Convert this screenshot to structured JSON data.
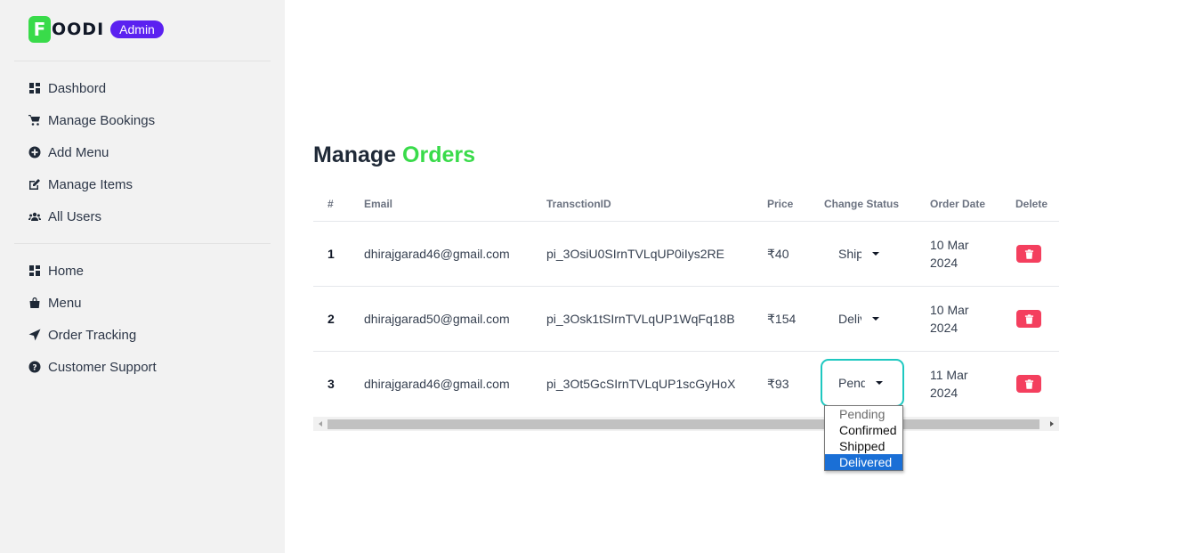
{
  "brand": {
    "logo_letter": "F",
    "logo_rest": "OODI",
    "badge": "Admin"
  },
  "sidebar": {
    "admin_items": [
      {
        "label": "Dashbord",
        "icon": "dashboard-icon"
      },
      {
        "label": "Manage Bookings",
        "icon": "cart-icon"
      },
      {
        "label": "Add Menu",
        "icon": "plus-circle-icon"
      },
      {
        "label": "Manage Items",
        "icon": "edit-icon"
      },
      {
        "label": "All Users",
        "icon": "users-icon"
      }
    ],
    "site_items": [
      {
        "label": "Home",
        "icon": "dashboard-icon"
      },
      {
        "label": "Menu",
        "icon": "shopping-bag-icon"
      },
      {
        "label": "Order Tracking",
        "icon": "location-arrow-icon"
      },
      {
        "label": "Customer Support",
        "icon": "question-circle-icon"
      }
    ]
  },
  "page": {
    "title_prefix": "Manage",
    "title_accent": "Orders"
  },
  "table": {
    "headers": [
      "#",
      "Email",
      "TransctionID",
      "Price",
      "Change Status",
      "Order Date",
      "Delete"
    ],
    "rows": [
      {
        "num": "1",
        "email": "dhirajgarad46@gmail.com",
        "txn": "pi_3OsiU0SIrnTVLqUP0iIys2RE",
        "price": "₹40",
        "status": "Shipped",
        "date_line1": "10 Mar",
        "date_line2": "2024"
      },
      {
        "num": "2",
        "email": "dhirajgarad50@gmail.com",
        "txn": "pi_3Osk1tSIrnTVLqUP1WqFq18B",
        "price": "₹154",
        "status": "Delivered",
        "date_line1": "10 Mar",
        "date_line2": "2024"
      },
      {
        "num": "3",
        "email": "dhirajgarad46@gmail.com",
        "txn": "pi_3Ot5GcSIrnTVLqUP1scGyHoX",
        "price": "₹93",
        "status": "Pending",
        "date_line1": "11 Mar",
        "date_line2": "2024"
      }
    ]
  },
  "status_dropdown": {
    "options": [
      "Pending",
      "Confirmed",
      "Shipped",
      "Delivered"
    ],
    "highlighted": "Delivered"
  },
  "colors": {
    "accent_green": "#39db4a",
    "badge_purple": "#5b21f0",
    "delete_red": "#f43f5e",
    "focus_teal": "#1ec8c0",
    "highlight_blue": "#1a6fd6"
  }
}
